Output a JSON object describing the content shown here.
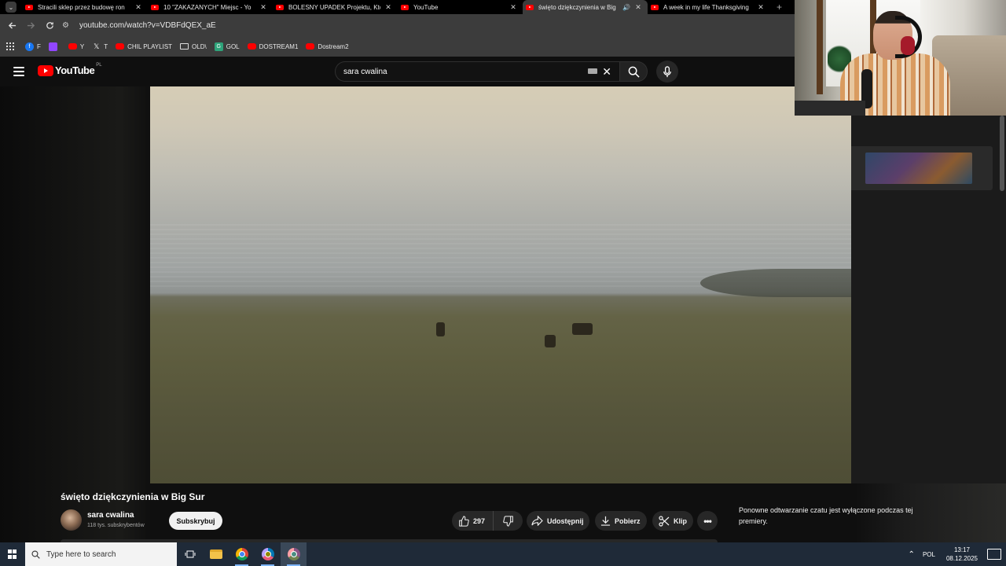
{
  "browser": {
    "tabs": [
      {
        "title": "Stracili sklep przez budowę ron",
        "active": false
      },
      {
        "title": "10 \"ZAKAZANYCH\" Miejsc - Yo",
        "active": false
      },
      {
        "title": "BOLESNY UPADEK Projektu, Któ",
        "active": false
      },
      {
        "title": "YouTube",
        "active": false
      },
      {
        "title": "święto dziękczynienia w Big",
        "active": true
      },
      {
        "title": "A week in my life Thanksgiving",
        "active": false
      }
    ],
    "url": "youtube.com/watch?v=VDBFdQEX_aE",
    "bookmarks": [
      {
        "label": "F",
        "icon": "facebook-icon"
      },
      {
        "label": "",
        "icon": "twitch-icon"
      },
      {
        "label": "Y",
        "icon": "youtube-icon"
      },
      {
        "label": "T",
        "icon": "x-icon"
      },
      {
        "label": "CHIL PLAYLIST",
        "icon": "youtube-icon"
      },
      {
        "label": "OLD\\",
        "icon": "folder-icon"
      },
      {
        "label": "GOL",
        "icon": "gol-icon"
      },
      {
        "label": "DOSTREAM1",
        "icon": "youtube-icon"
      },
      {
        "label": "Dostream2",
        "icon": "youtube-icon"
      }
    ]
  },
  "youtube": {
    "logo_text": "YouTube",
    "region": "PL",
    "search_query": "sara cwalina",
    "video": {
      "title": "święto dziękczynienia w Big Sur",
      "channel": "sara cwalina",
      "subscribers": "118 tys. subskrybentów",
      "subscribe_label": "Subskrybuj",
      "likes": "297",
      "share_label": "Udostępnij",
      "download_label": "Pobierz",
      "clip_label": "Klip",
      "more_label": "•••"
    },
    "chat_note": "Ponowne odtwarzanie czatu jest wyłączone podczas tej premiery."
  },
  "taskbar": {
    "search_placeholder": "Type here to search",
    "language": "POL",
    "time": "13:17",
    "date": "08.12.2025"
  },
  "colors": {
    "youtube_red": "#ff0000",
    "background": "#0f0f0f",
    "pill": "#272727",
    "taskbar": "#1f2a38"
  }
}
